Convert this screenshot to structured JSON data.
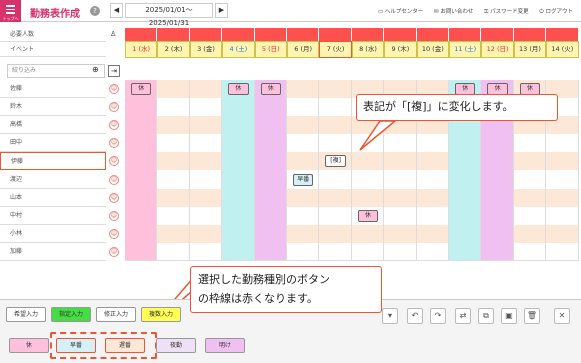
{
  "app": {
    "logo_label": "トップへ",
    "title": "勤務表作成",
    "help": "?"
  },
  "nav": {
    "prev": "◀",
    "range": "2025/01/01〜2025/01/31",
    "next": "▶"
  },
  "links": {
    "help_center": "ヘルプセンター",
    "contact": "お問い合わせ",
    "password": "パスワード変更",
    "logout": "ログアウト"
  },
  "left": {
    "required_label": "必要人数",
    "event_label": "イベント",
    "filter_placeholder": "絞り込み"
  },
  "dates": [
    "1 (水)",
    "2 (木)",
    "3 (金)",
    "4 (土)",
    "5 (日)",
    "6 (月)",
    "7 (火)",
    "8 (水)",
    "9 (木)",
    "10 (金)",
    "11 (土)",
    "12 (日)",
    "13 (月)",
    "14 (火)"
  ],
  "staff": [
    "佐藤",
    "鈴木",
    "高橋",
    "田中",
    "伊藤",
    "渡辺",
    "山本",
    "中村",
    "小林",
    "加藤"
  ],
  "shifts": [
    {
      "row": 0,
      "col": 0,
      "label": "休"
    },
    {
      "row": 0,
      "col": 3,
      "label": "休"
    },
    {
      "row": 0,
      "col": 4,
      "label": "休"
    },
    {
      "row": 0,
      "col": 10,
      "label": "休"
    },
    {
      "row": 0,
      "col": 11,
      "label": "休"
    },
    {
      "row": 0,
      "col": 12,
      "label": "休"
    },
    {
      "row": 4,
      "col": 6,
      "label": "[複]"
    },
    {
      "row": 5,
      "col": 5,
      "label": "早番"
    },
    {
      "row": 7,
      "col": 7,
      "label": "休"
    }
  ],
  "callouts": {
    "top": "表記が「[複]」に変化します。",
    "bottom_line1": "選択した勤務種別のボタン",
    "bottom_line2": "の枠線は赤くなります。"
  },
  "mode_buttons": [
    "希望入力",
    "指定入力",
    "修正入力",
    "複数入力"
  ],
  "shift_types": [
    "休",
    "早番",
    "遅番",
    "夜勤",
    "明け"
  ],
  "colors": {
    "accent": "#d6336c",
    "required": "#ff5050",
    "holiday": "#ffc0dc",
    "saturday": "#c0f0f0",
    "sunday": "#f0c0f0",
    "weekday_alt": "#fde8d8",
    "callout_border": "#ee5533"
  }
}
